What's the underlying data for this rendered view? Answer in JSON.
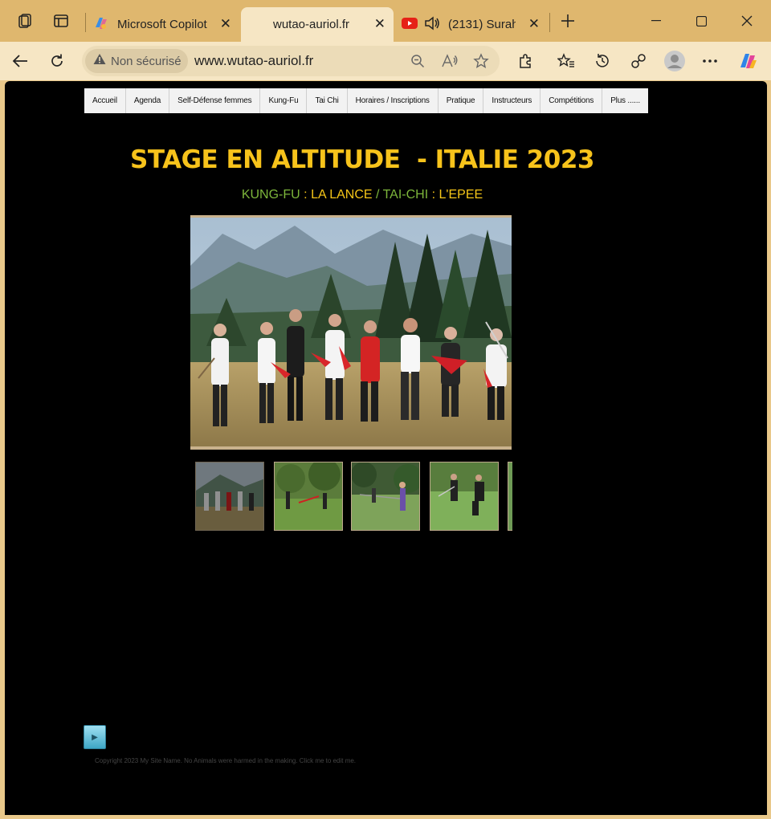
{
  "browser": {
    "tabs": [
      {
        "title": "Microsoft Copilot",
        "active": false
      },
      {
        "title": "wutao-auriol.fr",
        "active": true
      },
      {
        "title": "(2131) Surah",
        "active": false
      }
    ],
    "security_label": "Non sécurisé",
    "url": "www.wutao-auriol.fr",
    "colors": {
      "frame": "#dfb76e",
      "toolbar": "#f6e6c4",
      "page_bg": "#000000"
    },
    "icons": [
      "workspaces-icon",
      "tab-actions-icon",
      "new-tab-icon",
      "minimize-icon",
      "maximize-icon",
      "close-window-icon",
      "back-icon",
      "refresh-icon",
      "warning-icon",
      "zoom-icon",
      "read-aloud-icon",
      "favorite-star-icon",
      "extensions-icon",
      "favorites-icon",
      "history-icon",
      "performance-icon",
      "profile-icon",
      "more-icon",
      "copilot-icon"
    ]
  },
  "site": {
    "menu": [
      "Accueil",
      "Agenda",
      "Self-Défense femmes",
      "Kung-Fu",
      "Tai Chi",
      "Horaires / Inscriptions",
      "Pratique",
      "Instructeurs",
      "Compétitions",
      "Plus ......"
    ],
    "headline": "STAGE EN ALTITUDE  - ITALIE 2023",
    "subtitle": {
      "part1": "KUNG-FU",
      "sep1": " : ",
      "part2": "LA LANCE",
      "sep2": " / ",
      "part3": "TAI-CHI",
      "sep3": " : ",
      "part4": "L'EPEE"
    },
    "colors": {
      "headline": "#f7c31b",
      "green": "#7db63b",
      "yellow": "#f5c518"
    },
    "copyright": "Copyright 2023 My Site Name. No Animals were harmed in the making. Click me to edit me."
  }
}
